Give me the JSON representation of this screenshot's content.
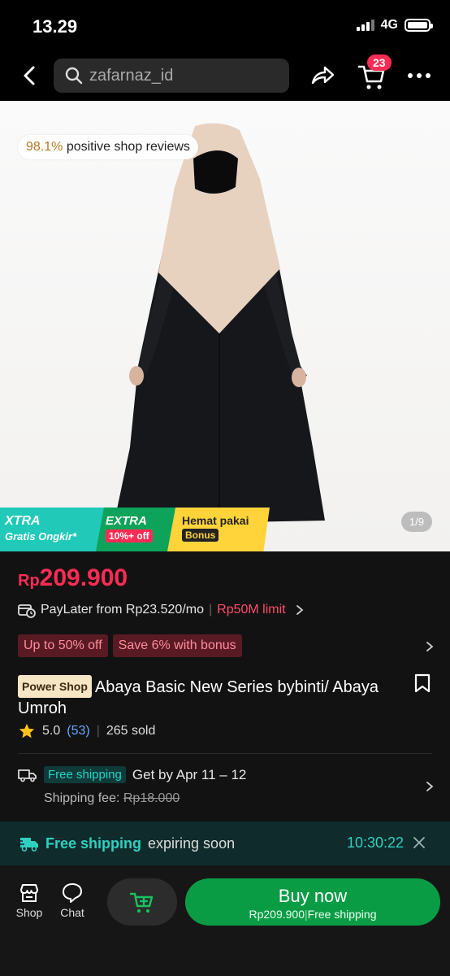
{
  "status_bar": {
    "time": "13.29",
    "network": "4G"
  },
  "header": {
    "search_text": "zafarnaz_id",
    "cart_count": "23"
  },
  "gallery": {
    "review_pct": "98.1%",
    "review_text": "positive shop reviews",
    "counter": "1/9",
    "promos": [
      {
        "line1": "XTRA",
        "line2": "Gratis Ongkir*"
      },
      {
        "line1": "EXTRA",
        "line2": "10%+ off"
      },
      {
        "line1": "Hemat pakai",
        "line2": "Bonus"
      }
    ]
  },
  "product": {
    "currency": "Rp",
    "price": "209.900",
    "paylater_text": "PayLater from Rp23.520/mo",
    "paylater_limit": "Rp50M limit",
    "chips": [
      "Up to 50% off",
      "Save 6% with bonus"
    ],
    "shop_badge": "Power Shop",
    "title": "Abaya Basic New Series bybinti/ Abaya Umroh",
    "rating": "5.0",
    "review_count": "(53)",
    "sold": "265 sold"
  },
  "shipping": {
    "badge": "Free shipping",
    "eta": "Get by Apr 11 – 12",
    "fee_label": "Shipping fee:",
    "fee_value": "Rp18.000"
  },
  "expiring_banner": {
    "emphasis": "Free shipping",
    "text": "expiring soon",
    "timer": "10:30:22"
  },
  "bottom_bar": {
    "shop_label": "Shop",
    "chat_label": "Chat",
    "buy_label": "Buy now",
    "buy_price": "Rp209.900",
    "buy_sub": "Free shipping"
  },
  "colors": {
    "accent_red": "#fe2c55",
    "buy_green": "#0a9c45",
    "teal": "#2fd0c0"
  }
}
